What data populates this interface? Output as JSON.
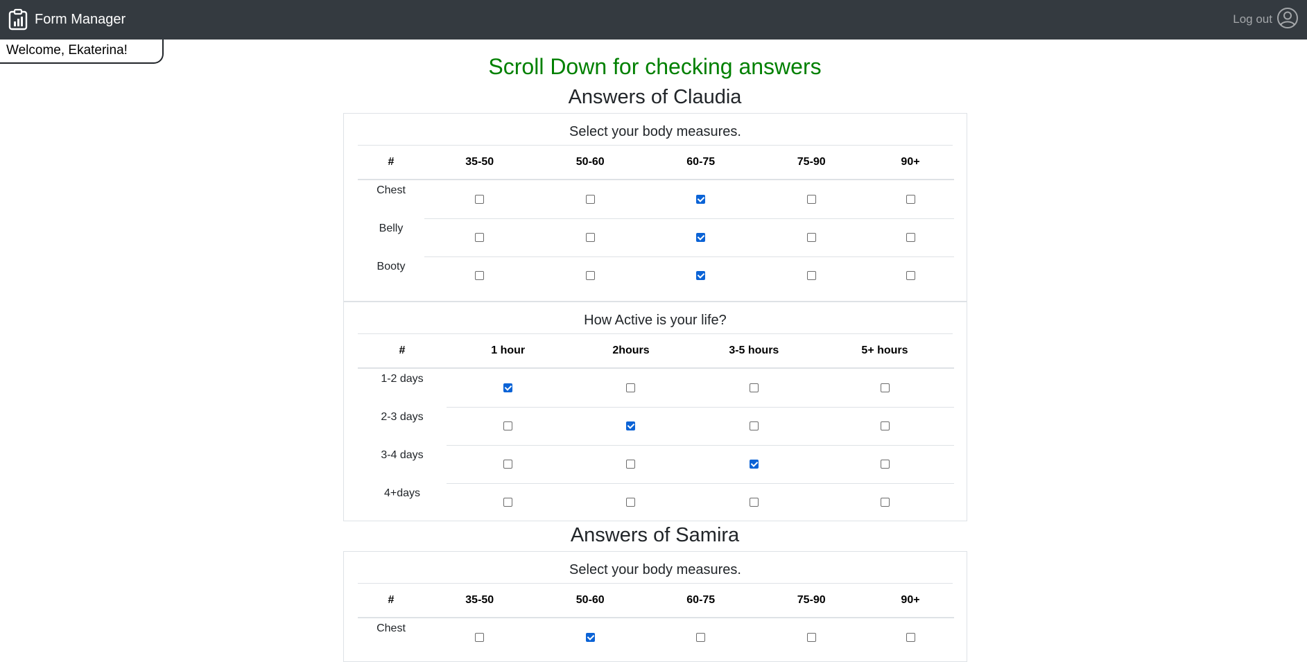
{
  "navbar": {
    "brand": "Form Manager",
    "logout": "Log out"
  },
  "welcome": "Welcome, Ekaterina!",
  "page_title": "Scroll Down for checking answers",
  "colors": {
    "title": "#008000",
    "navbar": "#343a40",
    "checkbox_checked": "#0b63d6"
  },
  "answers": [
    {
      "heading": "Answers of Claudia",
      "questions": [
        {
          "title": "Select your body measures.",
          "corner": "#",
          "columns": [
            "35-50",
            "50-60",
            "60-75",
            "75-90",
            "90+"
          ],
          "rows": [
            {
              "label": "Chest",
              "checked": [
                false,
                false,
                true,
                false,
                false
              ]
            },
            {
              "label": "Belly",
              "checked": [
                false,
                false,
                true,
                false,
                false
              ]
            },
            {
              "label": "Booty",
              "checked": [
                false,
                false,
                true,
                false,
                false
              ]
            }
          ]
        },
        {
          "title": "How Active is your life?",
          "corner": "#",
          "columns": [
            "1 hour",
            "2hours",
            "3-5 hours",
            "5+ hours"
          ],
          "rows": [
            {
              "label": "1-2 days",
              "checked": [
                true,
                false,
                false,
                false
              ]
            },
            {
              "label": "2-3 days",
              "checked": [
                false,
                true,
                false,
                false
              ]
            },
            {
              "label": "3-4 days",
              "checked": [
                false,
                false,
                true,
                false
              ]
            },
            {
              "label": "4+days",
              "checked": [
                false,
                false,
                false,
                false
              ]
            }
          ]
        }
      ]
    },
    {
      "heading": "Answers of Samira",
      "questions": [
        {
          "title": "Select your body measures.",
          "corner": "#",
          "columns": [
            "35-50",
            "50-60",
            "60-75",
            "75-90",
            "90+"
          ],
          "rows": [
            {
              "label": "Chest",
              "checked": [
                false,
                true,
                false,
                false,
                false
              ]
            }
          ]
        }
      ]
    }
  ]
}
